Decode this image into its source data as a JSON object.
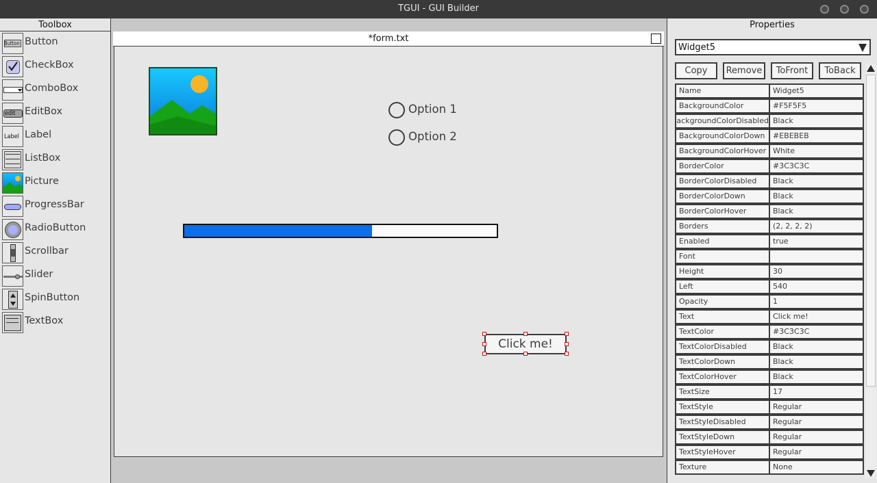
{
  "window": {
    "title": "TGUI - GUI Builder",
    "controls": [
      "window-button-1",
      "window-button-2",
      "window-button-3"
    ]
  },
  "toolbox": {
    "title": "Toolbox",
    "items": [
      {
        "label": "Button",
        "icon": "button-widget-icon",
        "icon_text": "Button"
      },
      {
        "label": "CheckBox",
        "icon": "checkbox-widget-icon"
      },
      {
        "label": "ComboBox",
        "icon": "combobox-widget-icon"
      },
      {
        "label": "EditBox",
        "icon": "editbox-widget-icon",
        "icon_text": "edit"
      },
      {
        "label": "Label",
        "icon": "label-widget-icon",
        "icon_text": "Label"
      },
      {
        "label": "ListBox",
        "icon": "listbox-widget-icon"
      },
      {
        "label": "Picture",
        "icon": "picture-widget-icon"
      },
      {
        "label": "ProgressBar",
        "icon": "progressbar-widget-icon"
      },
      {
        "label": "RadioButton",
        "icon": "radiobutton-widget-icon"
      },
      {
        "label": "Scrollbar",
        "icon": "scrollbar-widget-icon"
      },
      {
        "label": "Slider",
        "icon": "slider-widget-icon"
      },
      {
        "label": "SpinButton",
        "icon": "spinbutton-widget-icon"
      },
      {
        "label": "TextBox",
        "icon": "textbox-widget-icon"
      }
    ]
  },
  "form": {
    "title": "*form.txt",
    "radios": [
      {
        "label": "Option 1"
      },
      {
        "label": "Option 2"
      }
    ],
    "progress": {
      "value": 0.6
    },
    "button": {
      "text": "Click me!"
    },
    "colors": {
      "progress_fill": "#0A6FE8",
      "selection_handle": "#D01010"
    }
  },
  "properties": {
    "title": "Properties",
    "selected_widget": "Widget5",
    "buttons": {
      "copy": "Copy",
      "remove": "Remove",
      "to_front": "ToFront",
      "to_back": "ToBack"
    },
    "rows": [
      {
        "name": "Name",
        "value": "Widget5"
      },
      {
        "name": "BackgroundColor",
        "value": "#F5F5F5"
      },
      {
        "name": "BackgroundColorDisabled",
        "value": "Black"
      },
      {
        "name": "BackgroundColorDown",
        "value": "#EBEBEB"
      },
      {
        "name": "BackgroundColorHover",
        "value": "White"
      },
      {
        "name": "BorderColor",
        "value": "#3C3C3C"
      },
      {
        "name": "BorderColorDisabled",
        "value": "Black"
      },
      {
        "name": "BorderColorDown",
        "value": "Black"
      },
      {
        "name": "BorderColorHover",
        "value": "Black"
      },
      {
        "name": "Borders",
        "value": "(2, 2, 2, 2)"
      },
      {
        "name": "Enabled",
        "value": "true"
      },
      {
        "name": "Font",
        "value": ""
      },
      {
        "name": "Height",
        "value": "30"
      },
      {
        "name": "Left",
        "value": "540"
      },
      {
        "name": "Opacity",
        "value": "1"
      },
      {
        "name": "Text",
        "value": "Click me!"
      },
      {
        "name": "TextColor",
        "value": "#3C3C3C"
      },
      {
        "name": "TextColorDisabled",
        "value": "Black"
      },
      {
        "name": "TextColorDown",
        "value": "Black"
      },
      {
        "name": "TextColorHover",
        "value": "Black"
      },
      {
        "name": "TextSize",
        "value": "17"
      },
      {
        "name": "TextStyle",
        "value": "Regular"
      },
      {
        "name": "TextStyleDisabled",
        "value": "Regular"
      },
      {
        "name": "TextStyleDown",
        "value": "Regular"
      },
      {
        "name": "TextStyleHover",
        "value": "Regular"
      },
      {
        "name": "Texture",
        "value": "None"
      }
    ]
  }
}
